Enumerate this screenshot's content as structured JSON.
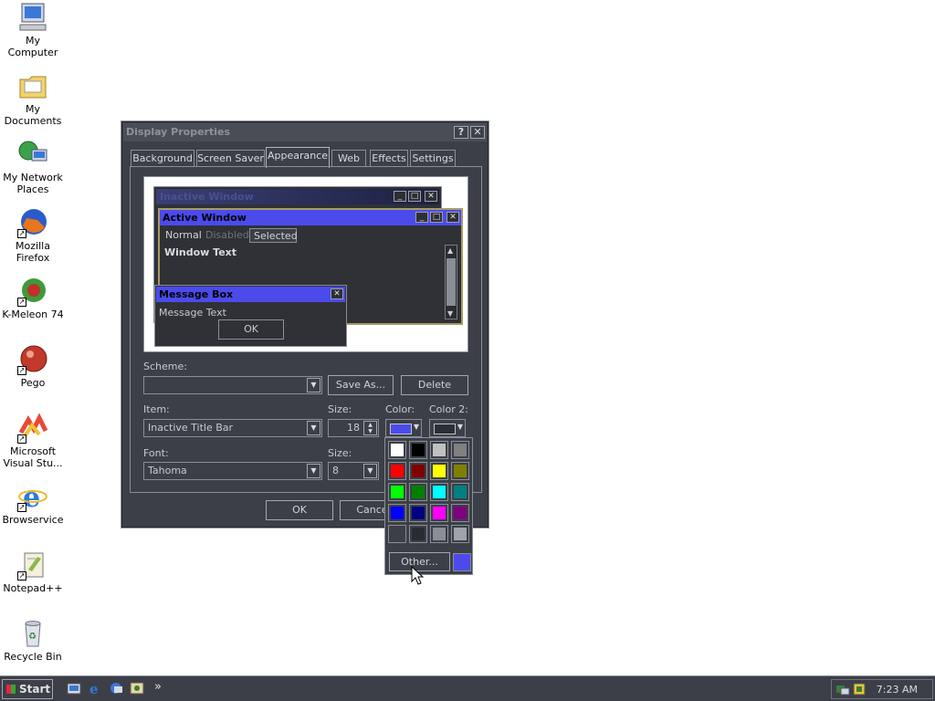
{
  "desktop": {
    "icons": [
      {
        "label": "My Computer",
        "icon": "computer-icon"
      },
      {
        "label": "My Documents",
        "icon": "folder-icon"
      },
      {
        "label": "My Network Places",
        "icon": "network-icon"
      },
      {
        "label": "Mozilla Firefox",
        "icon": "firefox-icon"
      },
      {
        "label": "K-Meleon 74",
        "icon": "kmeleon-icon"
      },
      {
        "label": "Pego",
        "icon": "pego-icon"
      },
      {
        "label": "Microsoft Visual Stu...",
        "icon": "visual-studio-icon"
      },
      {
        "label": "Browservice",
        "icon": "ie-icon"
      },
      {
        "label": "Notepad++",
        "icon": "notepad-icon"
      },
      {
        "label": "Recycle Bin",
        "icon": "recycle-bin-icon"
      }
    ]
  },
  "window": {
    "title": "Display Properties",
    "help_glyph": "?",
    "close_glyph": "✕",
    "tabs": [
      "Background",
      "Screen Saver",
      "Appearance",
      "Web",
      "Effects",
      "Settings"
    ],
    "selected_tab": "Appearance",
    "preview": {
      "inactive_title": "Inactive Window",
      "active_title": "Active Window",
      "menu": {
        "normal": "Normal",
        "disabled": "Disabled",
        "selected": "Selected"
      },
      "window_text": "Window Text",
      "message_title": "Message Box",
      "message_text": "Message Text",
      "ok": "OK"
    },
    "scheme": {
      "label": "Scheme:",
      "value": "",
      "save_as": "Save As...",
      "delete": "Delete"
    },
    "item": {
      "label": "Item:",
      "value": "Inactive Title Bar",
      "size_label": "Size:",
      "size_value": "18",
      "color_label": "Color:",
      "color2_label": "Color 2:"
    },
    "font": {
      "label": "Font:",
      "value": "Tahoma",
      "size_label": "Size:",
      "size_value": "8"
    },
    "buttons": {
      "ok": "OK",
      "cancel": "Cancel"
    }
  },
  "colors": {
    "color1": "#4b4bec",
    "color2": "#2c2f36",
    "palette": [
      "#ffffff",
      "#000000",
      "#c0c0c0",
      "#808080",
      "#ff0000",
      "#800000",
      "#ffff00",
      "#808000",
      "#00ff00",
      "#008000",
      "#00ffff",
      "#008080",
      "#0000ff",
      "#000080",
      "#ff00ff",
      "#800080",
      "#3c3f47",
      "#2a2c31",
      "#8a8f97",
      "#a0a4aa"
    ],
    "other_label": "Other...",
    "other_color": "#4b4bec"
  },
  "taskbar": {
    "start": "Start",
    "overflow": "»",
    "clock": "7:23 AM"
  }
}
